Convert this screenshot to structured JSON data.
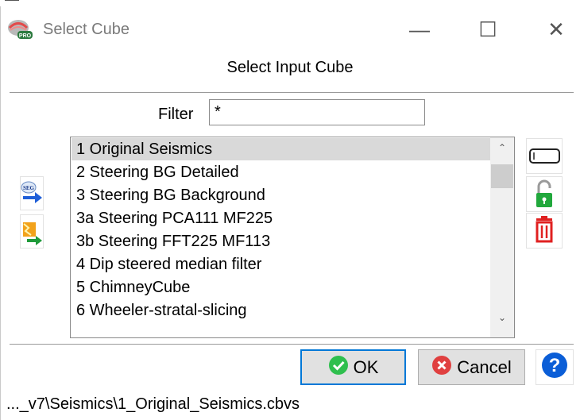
{
  "window": {
    "title": "Select Cube",
    "app_icon": "opendtect-pro-icon",
    "controls": [
      "minimize",
      "maximize",
      "close"
    ],
    "minimize_glyph": "—",
    "maximize_glyph": "☐",
    "close_glyph": "✕"
  },
  "header": {
    "title": "Select Input Cube"
  },
  "filter": {
    "label": "Filter",
    "value": "*"
  },
  "cube_list": {
    "selected_index": 0,
    "items": [
      "1 Original Seismics",
      "2 Steering BG Detailed",
      "3 Steering BG Background",
      "3a Steering PCA111 MF225",
      "3b Steering FFT225 MF113",
      "4 Dip steered median filter",
      "5 ChimneyCube",
      "6 Wheeler-stratal-slicing"
    ]
  },
  "left_tools": [
    {
      "icon": "segy-import-icon",
      "text": "SEG"
    },
    {
      "icon": "import-cube-icon"
    }
  ],
  "right_tools": [
    {
      "icon": "rename-icon"
    },
    {
      "icon": "lock-icon"
    },
    {
      "icon": "delete-icon"
    }
  ],
  "buttons": {
    "ok_label": "OK",
    "cancel_label": "Cancel",
    "help_label": "?"
  },
  "status_path": "..._v7\\Seismics\\1_Original_Seismics.cbvs",
  "colors": {
    "ok_icon": "#2fbf4e",
    "cancel_icon": "#e04040",
    "help_icon": "#0b5ed7",
    "delete_icon": "#e02020",
    "lock_icon": "#21a83c",
    "focus_border": "#0078d7"
  }
}
